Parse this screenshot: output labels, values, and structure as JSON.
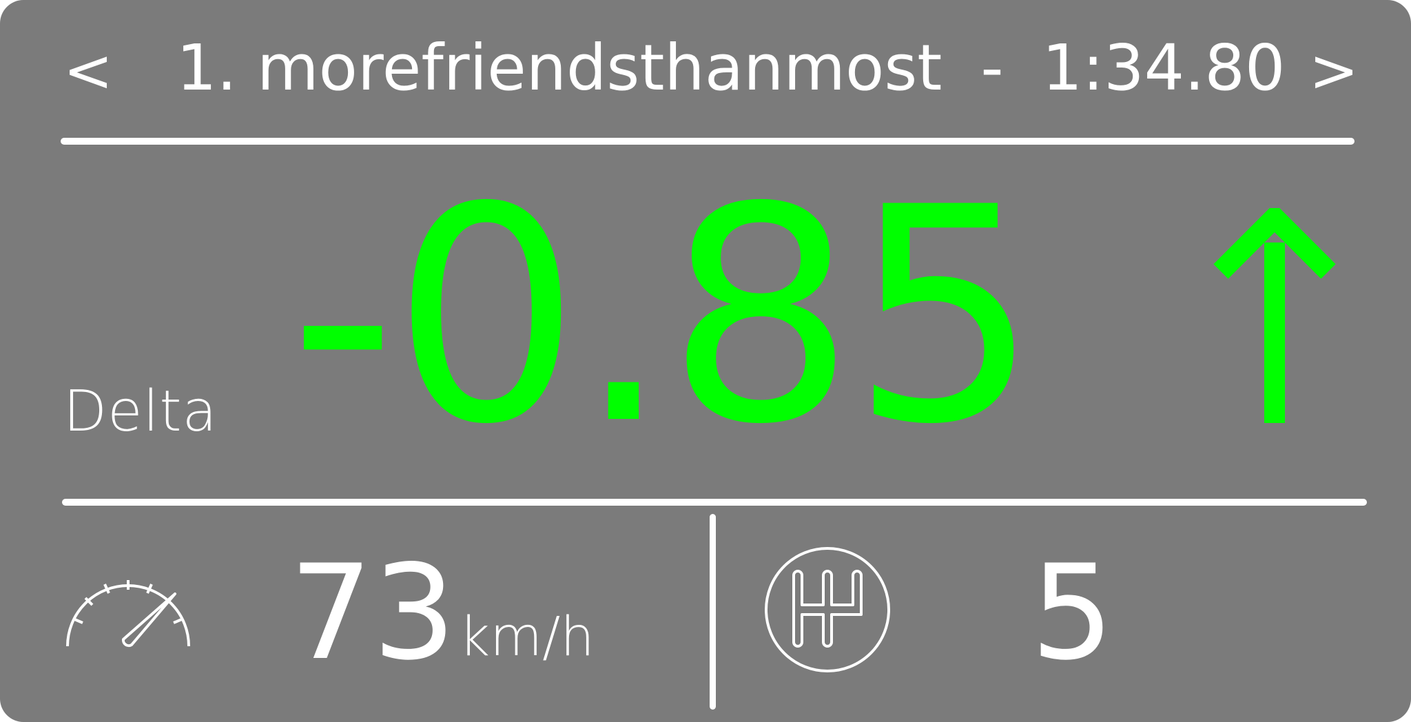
{
  "header": {
    "prev_label": "<",
    "next_label": ">",
    "position": "1.",
    "driver": "morefriendsthanmost",
    "separator": "-",
    "lap_time": "1:34.80"
  },
  "delta": {
    "label": "Delta",
    "value": "-0.85",
    "trend": "up",
    "color": "#00ff00",
    "arrow_icon": "arrow-up-icon"
  },
  "speed": {
    "icon": "speedometer-icon",
    "value": "73",
    "unit": "km/h"
  },
  "gear": {
    "icon": "gear-shift-icon",
    "value": "5"
  },
  "colors": {
    "background": "#7b7b7b",
    "foreground": "#ffffff",
    "accent": "#00ff00"
  }
}
